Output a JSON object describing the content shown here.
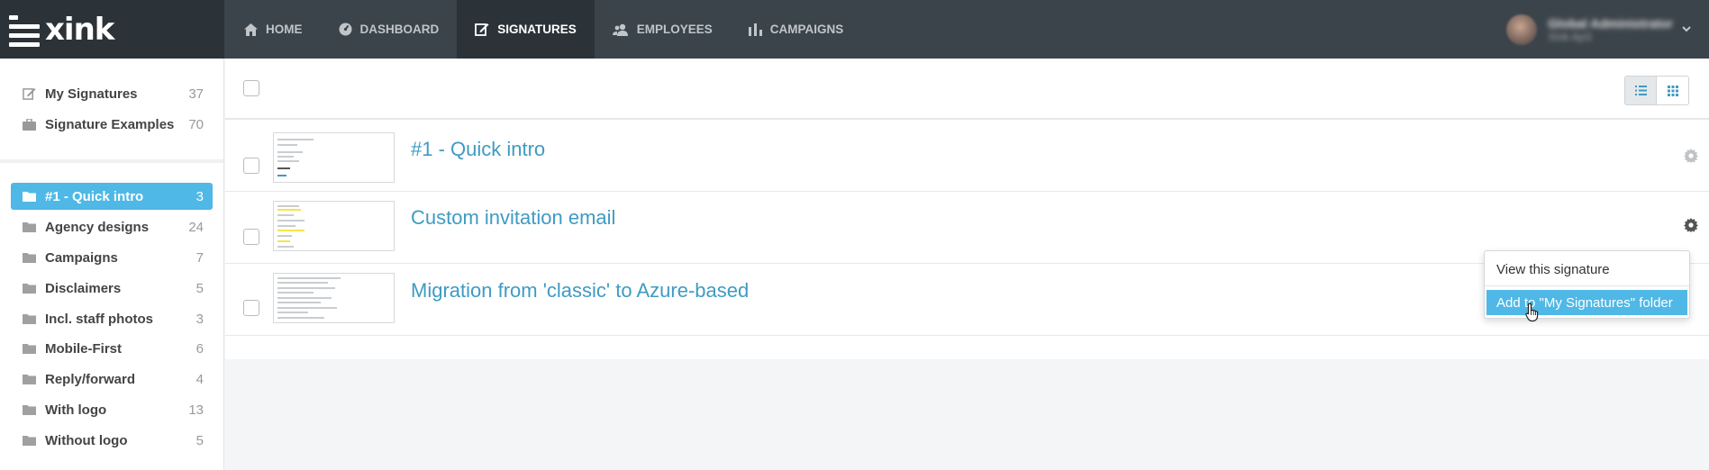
{
  "brand": {
    "name": "xink"
  },
  "nav": {
    "items": [
      {
        "label": "HOME",
        "icon": "home-icon"
      },
      {
        "label": "DASHBOARD",
        "icon": "dashboard-icon"
      },
      {
        "label": "SIGNATURES",
        "icon": "edit-icon",
        "active": true
      },
      {
        "label": "EMPLOYEES",
        "icon": "users-icon"
      },
      {
        "label": "CAMPAIGNS",
        "icon": "bar-chart-icon"
      }
    ]
  },
  "user": {
    "name": "Global Administrator",
    "subtitle": "Xink ApS"
  },
  "sidebar": {
    "top_items": [
      {
        "label": "My Signatures",
        "count": "37",
        "icon": "edit-icon"
      },
      {
        "label": "Signature Examples",
        "count": "70",
        "icon": "briefcase-icon"
      }
    ],
    "folders": [
      {
        "label": "#1 - Quick intro",
        "count": "3",
        "active": true
      },
      {
        "label": "Agency designs",
        "count": "24"
      },
      {
        "label": "Campaigns",
        "count": "7"
      },
      {
        "label": "Disclaimers",
        "count": "5"
      },
      {
        "label": "Incl. staff photos",
        "count": "3"
      },
      {
        "label": "Mobile-First",
        "count": "6"
      },
      {
        "label": "Reply/forward",
        "count": "4"
      },
      {
        "label": "With logo",
        "count": "13"
      },
      {
        "label": "Without logo",
        "count": "5"
      }
    ]
  },
  "signatures": [
    {
      "title": "#1 - Quick intro"
    },
    {
      "title": "Custom invitation email"
    },
    {
      "title": "Migration from 'classic' to Azure-based"
    }
  ],
  "context_menu": {
    "items": [
      {
        "label": "View this signature"
      },
      {
        "label": "Add to \"My Signatures\" folder",
        "highlighted": true
      }
    ]
  },
  "colors": {
    "accent": "#4fb8e6",
    "link": "#3f9bc3",
    "topbar": "#3b444b"
  }
}
